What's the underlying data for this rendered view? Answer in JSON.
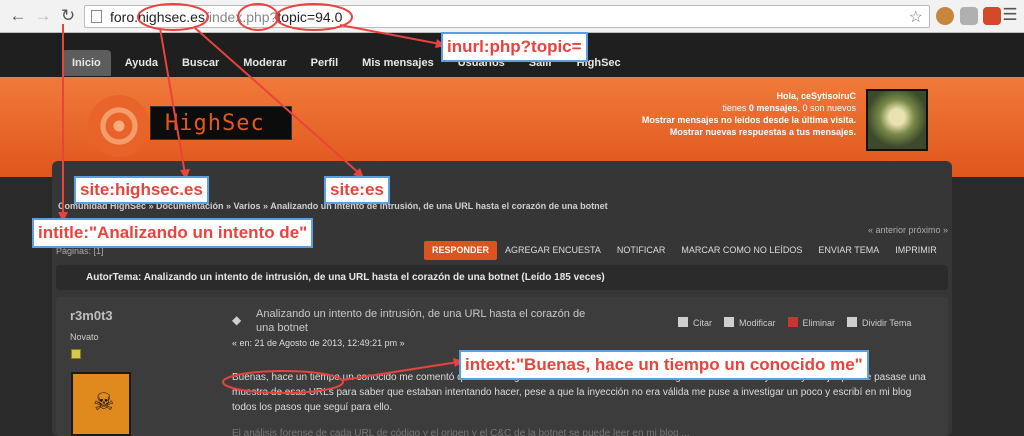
{
  "browser": {
    "url_host_prefix": "foro.",
    "url_host": "highsec.es",
    "url_slash": "/",
    "url_file": "index.php",
    "url_query_prefix": "?",
    "url_query": "topic=94.0"
  },
  "menu": {
    "items": [
      "Inicio",
      "Ayuda",
      "Buscar",
      "Moderar",
      "Perfil",
      "Mis mensajes",
      "Usuarios",
      "Salir",
      "HighSec"
    ]
  },
  "banner": {
    "logo_text": "HighSec",
    "greeting": "Hola, ceSytisoiruC",
    "messages_line_pre": "tienes",
    "messages_count": "0 mensajes",
    "messages_line_post": ", 0 son nuevos",
    "unread_link": "Mostrar mensajes no leídos desde la última visita.",
    "replies_link": "Mostrar nuevas respuestas a tus mensajes."
  },
  "forum": {
    "breadcrumb": "Comunidad HighSec » Documentación » Varios » Analizando un intento de intrusión, de una URL hasta el corazón de una botnet",
    "page_nav": "« anterior próximo »",
    "pages": "Páginas: [1]",
    "actions": [
      "RESPONDER",
      "AGREGAR ENCUESTA",
      "NOTIFICAR",
      "MARCAR COMO NO LEÍDOS",
      "ENVIAR TEMA",
      "IMPRIMIR"
    ],
    "topic_header": "AutorTema: Analizando un intento de intrusión, de una URL hasta el corazón de una botnet  (Leído 185 veces)"
  },
  "post": {
    "author": "r3m0t3",
    "rank": "Novato",
    "title": "Analizando un intento de intrusión, de una URL hasta el corazón de una botnet",
    "date": "« en: 21 de Agosto de 2013, 12:49:21 pm »",
    "tools": [
      "Citar",
      "Modificar",
      "Eliminar",
      "Dividir Tema"
    ],
    "body": "Buenas, hace un tiempo un conocido me comentó que en los logs de su servidor había detectado algunos intentos de inyección y le dijo que me pasase una muestra de esas URLs para saber que estaban intentando hacer, pese a que la inyección no era válida me puse a investigar un poco y escribí en mi blog todos los pasos que seguí para ello.",
    "body_next": "El análisis forense de cada URL de código y el origen y el C&C de la botnet se puede leer en mi blog ..."
  },
  "annotations": {
    "inurl": "inurl:php?topic=",
    "site_highsec": "site:highsec.es",
    "site_es": "site:es",
    "intitle": "intitle:\"Analizando un intento de\"",
    "intext": "intext:\"Buenas, hace un tiempo un conocido me\""
  },
  "colors": {
    "annotation_text": "#e8433c",
    "annotation_border": "#5a9fe0",
    "banner_orange": "#e8632a"
  }
}
